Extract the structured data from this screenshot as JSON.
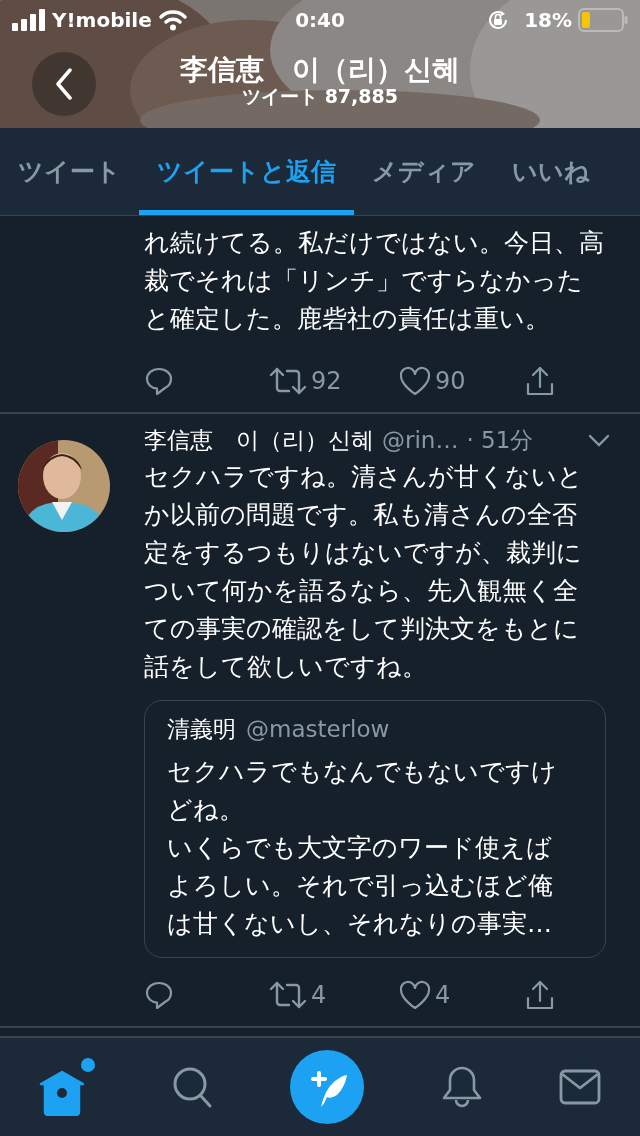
{
  "status_bar": {
    "carrier": "Y!mobile",
    "time": "0:40",
    "battery_text": "18%"
  },
  "header": {
    "title": "李信恵　이（리）신혜",
    "subtitle": "ツイート 87,885"
  },
  "tabs": [
    {
      "label": "ツイート",
      "selected": false
    },
    {
      "label": "ツイートと返信",
      "selected": true
    },
    {
      "label": "メディア",
      "selected": false
    },
    {
      "label": "いいね",
      "selected": false
    }
  ],
  "tweets": [
    {
      "kind": "partial",
      "text": "れ続けてる。私だけではない。今日、高裁でそれは「リンチ」ですらなかったと確定した。鹿砦社の責任は重い。",
      "retweets": "92",
      "likes": "90"
    },
    {
      "kind": "full",
      "author": "李信恵　이（리）신혜",
      "handle": "@rin…",
      "time": "· 51分",
      "text": "セクハラですね。清さんが甘くないとか以前の問題です。私も清さんの全否定をするつもりはないですが、裁判について何かを語るなら、先入観無く全ての事実の確認をして判決文をもとに話をして欲しいですね。",
      "quote": {
        "author": "清義明",
        "handle": "@masterlow",
        "paragraphs": [
          "セクハラでもなんでもないですけどね。",
          "いくらでも大文字のワード使えばよろしい。それで引っ込むほど俺は甘くないし、それなりの事実…"
        ]
      },
      "retweets": "4",
      "likes": "4"
    }
  ],
  "bottom_nav": [
    {
      "kind": "home",
      "selected": true,
      "badge": true
    },
    {
      "kind": "search",
      "selected": false,
      "badge": false
    },
    {
      "kind": "compose",
      "selected": false,
      "badge": false
    },
    {
      "kind": "notifications",
      "selected": false,
      "badge": false
    },
    {
      "kind": "messages",
      "selected": false,
      "badge": false
    }
  ]
}
